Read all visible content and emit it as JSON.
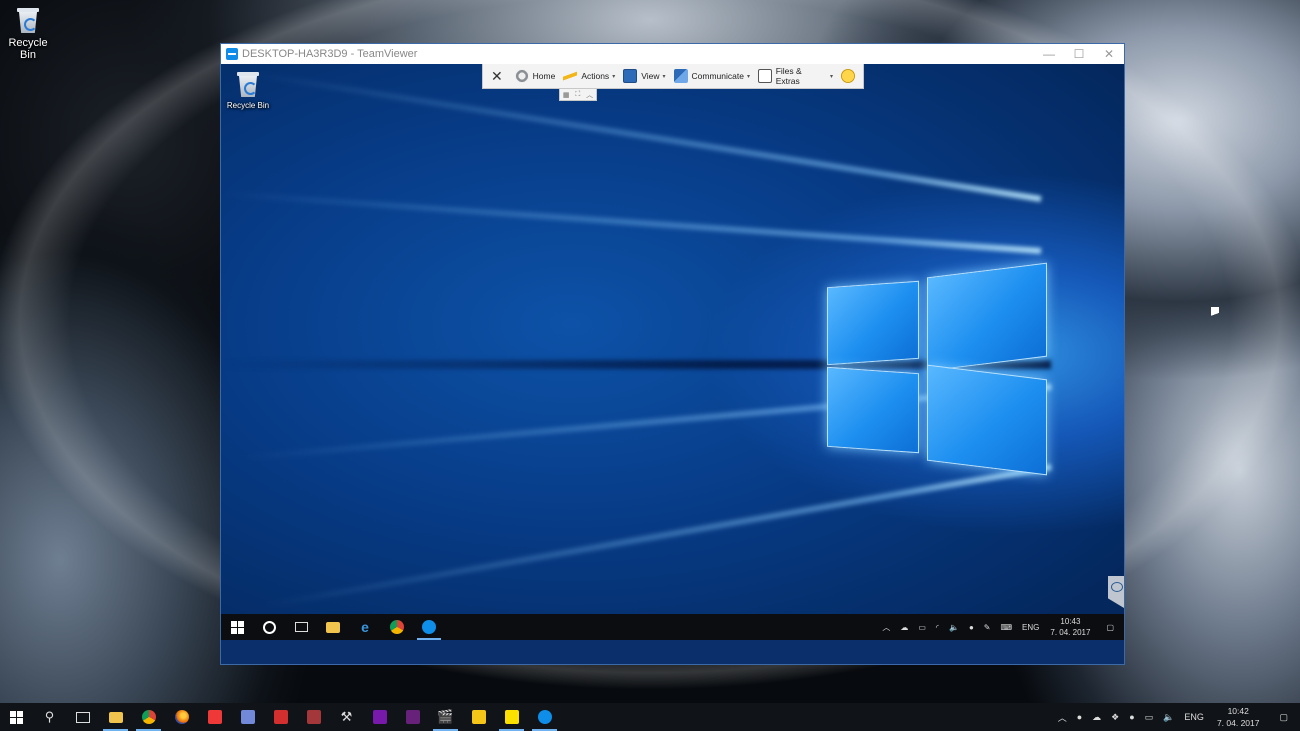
{
  "host_desktop": {
    "icons": [
      {
        "label": "Recycle Bin",
        "icon": "recycle-bin-icon"
      }
    ]
  },
  "teamviewer": {
    "title": "DESKTOP-HA3R3D9 - TeamViewer",
    "window_controls": {
      "minimize": "—",
      "maximize": "☐",
      "close": "✕"
    },
    "toolbar": {
      "close": "✕",
      "home": "Home",
      "actions": "Actions",
      "view": "View",
      "communicate": "Communicate",
      "files_extras": "Files & Extras",
      "caret": "▾"
    }
  },
  "remote_desktop": {
    "icons": [
      {
        "label": "Recycle Bin",
        "icon": "recycle-bin-icon"
      }
    ],
    "taskbar": {
      "language": "ENG",
      "time": "10:43",
      "date": "7. 04. 2017"
    }
  },
  "host_taskbar": {
    "language": "ENG",
    "time": "10:42",
    "date": "7. 04. 2017"
  },
  "colors": {
    "accent": "#0e8ee9",
    "remote_bg": "#073b86",
    "taskbar": "#101317"
  }
}
